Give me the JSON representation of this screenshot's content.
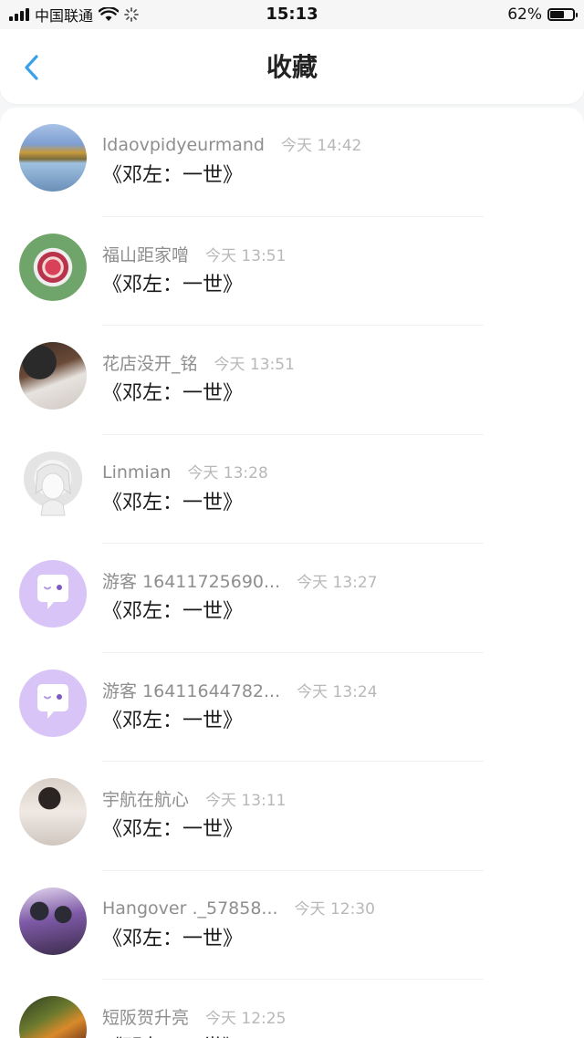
{
  "status_bar": {
    "carrier": "中国联通",
    "time": "15:13",
    "battery": "62%",
    "battery_level": 0.62
  },
  "nav": {
    "title": "收藏",
    "back_icon": "chevron-left-icon"
  },
  "favorites": [
    {
      "user": "ldaovpidyeurmand",
      "time": "今天 14:42",
      "song": "《邓左：一世》",
      "avatar": "landscape-lake-avatar"
    },
    {
      "user": "福山距家噌",
      "time": "今天 13:51",
      "song": "《邓左：一世》",
      "avatar": "rose-mandala-avatar"
    },
    {
      "user": "花店没开_铭",
      "time": "今天 13:51",
      "song": "《邓左：一世》",
      "avatar": "man-photo-avatar"
    },
    {
      "user": "Linmian",
      "time": "今天 13:28",
      "song": "《邓左：一世》",
      "avatar": "anime-girl-avatar"
    },
    {
      "user": "游客 16411725690...",
      "time": "今天 13:27",
      "song": "《邓左：一世》",
      "avatar": "guest-chat-bubble-avatar"
    },
    {
      "user": "游客 16411644782...",
      "time": "今天 13:24",
      "song": "《邓左：一世》",
      "avatar": "guest-chat-bubble-avatar"
    },
    {
      "user": "宇航在航心",
      "time": "今天 13:11",
      "song": "《邓左：一世》",
      "avatar": "boy-photo-avatar"
    },
    {
      "user": "Hangover ._57858...",
      "time": "今天 12:30",
      "song": "《邓左：一世》",
      "avatar": "group-photo-avatar"
    },
    {
      "user": "短阪贺升亮",
      "time": "今天 12:25",
      "song": "《邓左：一世》",
      "avatar": "fish-photo-avatar"
    }
  ],
  "colors": {
    "accent": "#3aa0e8",
    "guest_avatar_bg": "#d8c4f6",
    "username": "#8e8e8e",
    "timestamp": "#b8b8b8",
    "song_title": "#1a1a1a"
  }
}
